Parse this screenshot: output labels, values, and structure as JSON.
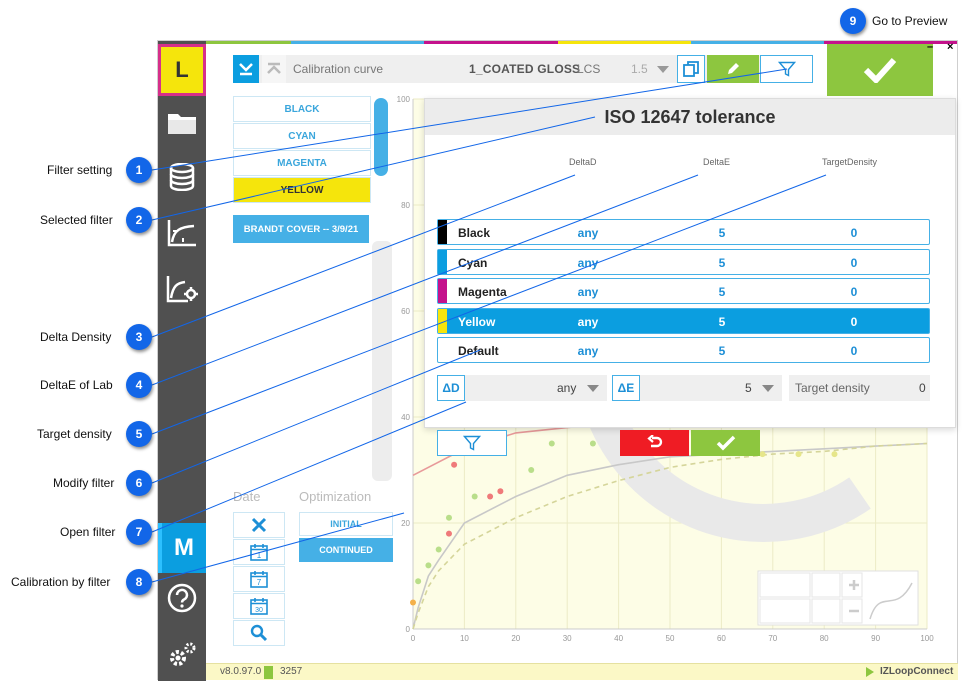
{
  "annotations": [
    {
      "n": "1",
      "label": "Filter setting"
    },
    {
      "n": "2",
      "label": "Selected filter"
    },
    {
      "n": "3",
      "label": "Delta Density"
    },
    {
      "n": "4",
      "label": "DeltaE of Lab"
    },
    {
      "n": "5",
      "label": "Target density"
    },
    {
      "n": "6",
      "label": "Modify filter"
    },
    {
      "n": "7",
      "label": "Open filter"
    },
    {
      "n": "8",
      "label": "Calibration by filter"
    },
    {
      "n": "9",
      "label": "Go to Preview"
    }
  ],
  "nav": {
    "logo": "L",
    "mode": "M"
  },
  "toolbar": {
    "title": "Calibration curve",
    "paper": "1_COATED GLOSS",
    "lcs_label": "LCS",
    "lcs_value": "1.5"
  },
  "window_controls": {
    "minimize": "–",
    "close": "×"
  },
  "colors": {
    "accent": "#0b9ee0",
    "green": "#8dc63f",
    "red": "#ef1c24",
    "yellow": "#f5e50c",
    "magenta": "#c4128c",
    "black": "#000000",
    "cyan": "#0b9ee0"
  },
  "color_list": [
    {
      "label": "BLACK",
      "selected": false
    },
    {
      "label": "CYAN",
      "selected": false
    },
    {
      "label": "MAGENTA",
      "selected": false
    },
    {
      "label": "YELLOW",
      "selected": true
    }
  ],
  "job": {
    "label": "BRANDT COVER -- 3/9/21"
  },
  "sidebar": {
    "date_title": "Date",
    "optimization_title": "Optimization",
    "date_buttons": [
      {
        "icon": "close-icon",
        "text": ""
      },
      {
        "icon": "calendar-icon",
        "text": "1"
      },
      {
        "icon": "calendar-icon",
        "text": "7"
      },
      {
        "icon": "calendar-icon",
        "text": "30"
      },
      {
        "icon": "search-icon",
        "text": ""
      }
    ],
    "opt_initial": "INITIAL",
    "opt_continued": "CONTINUED"
  },
  "dialog": {
    "title": "ISO 12647 tolerance",
    "columns": [
      "DeltaD",
      "DeltaE",
      "TargetDensity"
    ],
    "rows": [
      {
        "name": "Black",
        "deltaD": "any",
        "deltaE": "5",
        "target": "0",
        "swatch": "#000000",
        "active": false
      },
      {
        "name": "Cyan",
        "deltaD": "any",
        "deltaE": "5",
        "target": "0",
        "swatch": "#0b9ee0",
        "active": false
      },
      {
        "name": "Magenta",
        "deltaD": "any",
        "deltaE": "5",
        "target": "0",
        "swatch": "#c4128c",
        "active": false
      },
      {
        "name": "Yellow",
        "deltaD": "any",
        "deltaE": "5",
        "target": "0",
        "swatch": "#f5e50c",
        "active": true
      },
      {
        "name": "Default",
        "deltaD": "any",
        "deltaE": "5",
        "target": "0",
        "swatch": "",
        "active": false
      }
    ],
    "edit": {
      "deltaD_icon": "ΔD",
      "deltaD_value": "any",
      "deltaE_icon": "ΔE",
      "deltaE_value": "5",
      "target_label": "Target density",
      "target_value": "0"
    }
  },
  "chart_data": {
    "type": "line",
    "x_ticks": [
      "0",
      "10",
      "20",
      "30",
      "40",
      "50",
      "60",
      "70",
      "80",
      "90",
      "100"
    ],
    "y_ticks": [
      "0",
      "20",
      "40",
      "60",
      "80",
      "100"
    ],
    "xlim": [
      0,
      100
    ],
    "ylim": [
      0,
      100
    ],
    "series": [
      {
        "color": "#c8c8c8",
        "dashed": false,
        "x": [
          0,
          1,
          3,
          5,
          10,
          20,
          30,
          40,
          50,
          60,
          70,
          80,
          90,
          100
        ],
        "y": [
          0,
          4,
          10,
          13,
          20,
          25,
          29,
          31,
          32.5,
          33,
          33.5,
          34,
          34.5,
          35
        ]
      },
      {
        "color": "#d5d59a",
        "dashed": true,
        "x": [
          0,
          1,
          3,
          5,
          10,
          20,
          30,
          40,
          50,
          60,
          70,
          80,
          90,
          100
        ],
        "y": [
          0,
          3,
          8,
          11,
          16,
          21,
          25,
          28,
          30.5,
          32,
          33,
          33.5,
          34.5,
          35
        ]
      },
      {
        "color": "#e89a9a",
        "dashed": false,
        "x": [
          0,
          10,
          20,
          30,
          40
        ],
        "y": [
          29,
          34,
          37,
          38,
          39
        ]
      }
    ],
    "points": [
      {
        "x": 0,
        "y": 5,
        "color": "#f4b14a"
      },
      {
        "x": 1,
        "y": 9,
        "color": "#b9de8a"
      },
      {
        "x": 3,
        "y": 12,
        "color": "#b9de8a"
      },
      {
        "x": 5,
        "y": 15,
        "color": "#b9de8a"
      },
      {
        "x": 7,
        "y": 18,
        "color": "#ef7a7a"
      },
      {
        "x": 7,
        "y": 21,
        "color": "#b9de8a"
      },
      {
        "x": 8,
        "y": 31,
        "color": "#ef7a7a"
      },
      {
        "x": 12,
        "y": 25,
        "color": "#b9de8a"
      },
      {
        "x": 15,
        "y": 25,
        "color": "#ef7a7a"
      },
      {
        "x": 17,
        "y": 26,
        "color": "#ef7a7a"
      },
      {
        "x": 23,
        "y": 30,
        "color": "#b9de8a"
      },
      {
        "x": 27,
        "y": 35,
        "color": "#b9de8a"
      },
      {
        "x": 35,
        "y": 35,
        "color": "#b9de8a"
      },
      {
        "x": 68,
        "y": 33,
        "color": "#e6e68a"
      },
      {
        "x": 75,
        "y": 33,
        "color": "#e6e68a"
      },
      {
        "x": 82,
        "y": 33,
        "color": "#e6e68a"
      }
    ]
  },
  "status": {
    "version": "v8.0.97.0",
    "count": "3257",
    "connect": "IZLoopConnect"
  }
}
